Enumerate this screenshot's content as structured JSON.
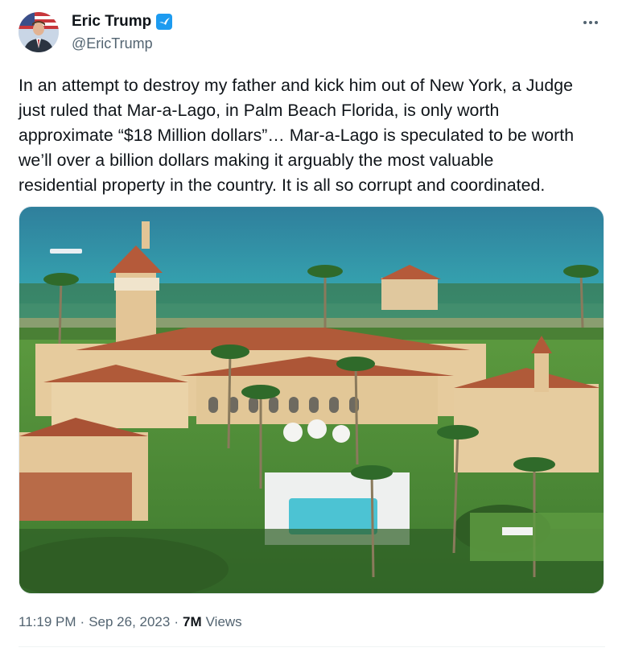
{
  "author": {
    "display_name": "Eric Trump",
    "handle": "@EricTrump",
    "verified": true,
    "verified_color": "#1d9bf0"
  },
  "tweet": {
    "text": "In an attempt to destroy my father and kick him out of New York, a Judge\njust ruled that Mar-a-Lago, in Palm Beach Florida, is only worth\napproximate “$18 Million dollars”… Mar-a-Lago is speculated to be worth\nwe’ll over a billion dollars making it arguably the most valuable\nresidential property in the country. It is all so corrupt and coordinated.",
    "time": "11:19 PM",
    "date": "Sep 26, 2023",
    "separator": "·",
    "views_count": "7M",
    "views_label": "Views"
  },
  "icons": {
    "more": "more-horizontal-icon",
    "verified": "verified-badge-icon"
  },
  "colors": {
    "text_primary": "#0f1419",
    "text_secondary": "#536471",
    "ocean": "#2a9bb0",
    "roof": "#b0583a",
    "stucco": "#e7cfa4",
    "lawn": "#4f8f3a"
  }
}
